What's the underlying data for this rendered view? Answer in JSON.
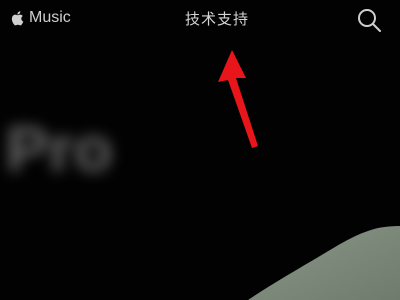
{
  "nav": {
    "brand_label": "Music",
    "tech_support_label": "技术支持",
    "search_icon": "search-icon",
    "apple_icon": "apple-logo-icon"
  },
  "hero": {
    "blurred_title": "Pro",
    "blurred_subtitle": "",
    "blurred_caption": ""
  },
  "annotation": {
    "arrow_color": "#e8151b",
    "target": "tech-support-link"
  },
  "colors": {
    "background": "#020202",
    "nav_text": "#d4d4d4",
    "device_fill": "#7d8a7b"
  }
}
